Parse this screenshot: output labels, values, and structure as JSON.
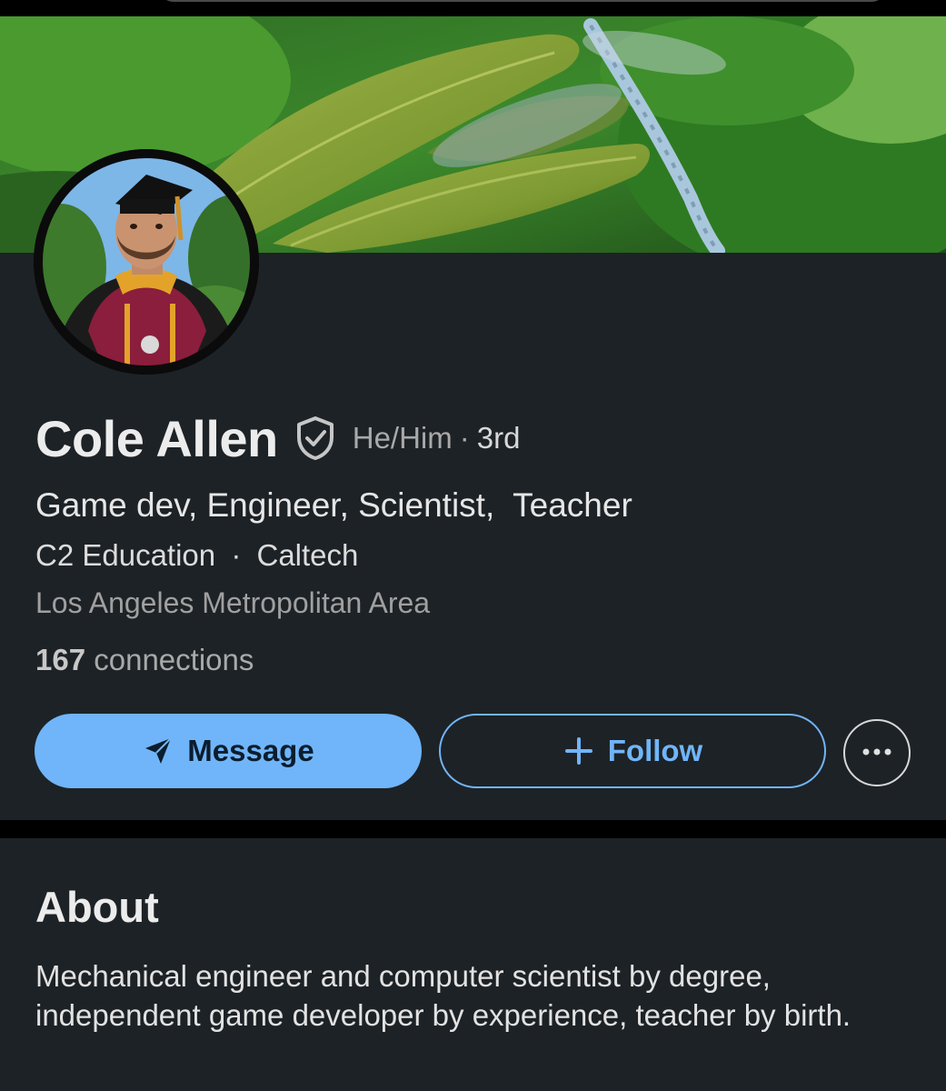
{
  "profile": {
    "name": "Cole Allen",
    "pronouns": "He/Him",
    "separator": "·",
    "degree": "3rd",
    "headline": "Game dev, Engineer, Scientist,  Teacher",
    "company": "C2 Education",
    "school": "Caltech",
    "location": "Los Angeles Metropolitan Area",
    "connections_count": "167",
    "connections_label": "connections"
  },
  "actions": {
    "message_label": "Message",
    "follow_label": "Follow",
    "message_icon": "send-icon",
    "follow_icon": "plus-icon",
    "more_icon": "more-horizontal-icon"
  },
  "about": {
    "title": "About",
    "text": "Mechanical engineer and computer scientist by degree, independent game developer by experience, teacher by birth."
  },
  "theme": {
    "card_bg": "#1d2226",
    "accent": "#70b5f9",
    "page_bg": "#000000"
  }
}
